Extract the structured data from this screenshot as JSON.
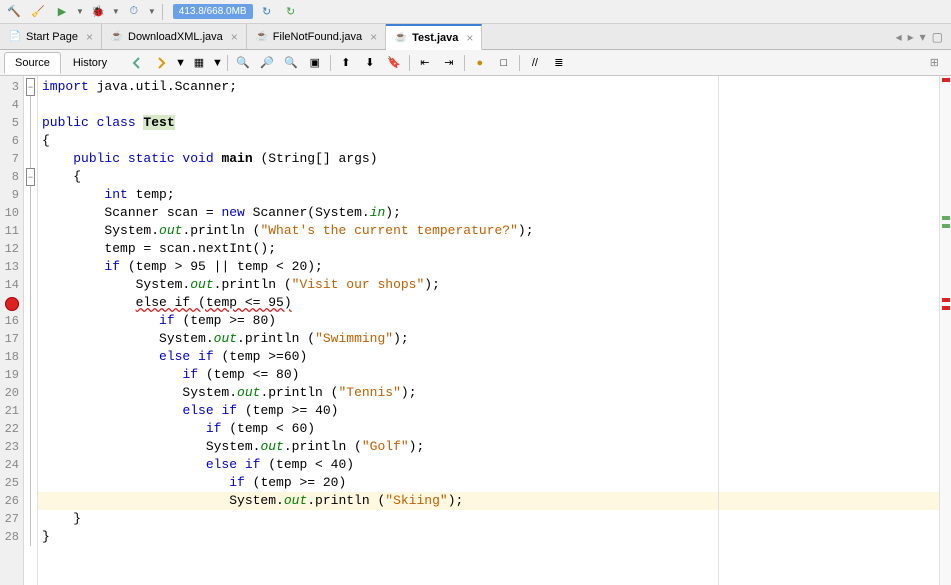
{
  "memory": "413.8/668.0MB",
  "tabs": [
    {
      "label": "Start Page",
      "icon": "page",
      "active": false
    },
    {
      "label": "DownloadXML.java",
      "icon": "java",
      "active": false
    },
    {
      "label": "FileNotFound.java",
      "icon": "java",
      "active": false
    },
    {
      "label": "Test.java",
      "icon": "java",
      "active": true
    }
  ],
  "views": {
    "source": "Source",
    "history": "History"
  },
  "gutter": [
    "3",
    "4",
    "5",
    "6",
    "7",
    "8",
    "9",
    "10",
    "11",
    "12",
    "13",
    "14",
    "",
    "16",
    "17",
    "18",
    "19",
    "20",
    "21",
    "22",
    "23",
    "24",
    "25",
    "26",
    "27",
    "28"
  ],
  "error_line_index": 12,
  "highlight_index": 23,
  "code": [
    [
      {
        "t": "import ",
        "c": "kw"
      },
      {
        "t": "java.util.Scanner;"
      }
    ],
    [
      {
        "t": ""
      }
    ],
    [
      {
        "t": "public class ",
        "c": "kw"
      },
      {
        "t": "Test",
        "c": "classname"
      }
    ],
    [
      {
        "t": "{"
      }
    ],
    [
      {
        "t": "    "
      },
      {
        "t": "public static void ",
        "c": "kw"
      },
      {
        "t": "main",
        "c": "method"
      },
      {
        "t": " (String[] args)"
      }
    ],
    [
      {
        "t": "    {"
      }
    ],
    [
      {
        "t": "        "
      },
      {
        "t": "int ",
        "c": "kw"
      },
      {
        "t": "temp;"
      }
    ],
    [
      {
        "t": "        Scanner scan = "
      },
      {
        "t": "new ",
        "c": "kw"
      },
      {
        "t": "Scanner(System."
      },
      {
        "t": "in",
        "c": "field"
      },
      {
        "t": ");"
      }
    ],
    [
      {
        "t": "        System."
      },
      {
        "t": "out",
        "c": "field"
      },
      {
        "t": ".println ("
      },
      {
        "t": "\"What's the current temperature?\"",
        "c": "str"
      },
      {
        "t": ");"
      }
    ],
    [
      {
        "t": "        temp = scan.nextInt();"
      }
    ],
    [
      {
        "t": "        "
      },
      {
        "t": "if ",
        "c": "kw"
      },
      {
        "t": "(temp > 95 || temp < 20);"
      }
    ],
    [
      {
        "t": "            System."
      },
      {
        "t": "out",
        "c": "field"
      },
      {
        "t": ".println ("
      },
      {
        "t": "\"Visit our shops\"",
        "c": "str"
      },
      {
        "t": ");"
      }
    ],
    [
      {
        "t": "            "
      },
      {
        "t": "else if (temp <= 95)",
        "c": "err-underline"
      }
    ],
    [
      {
        "t": "               "
      },
      {
        "t": "if ",
        "c": "kw"
      },
      {
        "t": "(temp >= 80)"
      }
    ],
    [
      {
        "t": "               System."
      },
      {
        "t": "out",
        "c": "field"
      },
      {
        "t": ".println ("
      },
      {
        "t": "\"Swimming\"",
        "c": "str"
      },
      {
        "t": ");"
      }
    ],
    [
      {
        "t": "               "
      },
      {
        "t": "else if ",
        "c": "kw"
      },
      {
        "t": "(temp >=60)"
      }
    ],
    [
      {
        "t": "                  "
      },
      {
        "t": "if ",
        "c": "kw"
      },
      {
        "t": "(temp <= 80)"
      }
    ],
    [
      {
        "t": "                  System."
      },
      {
        "t": "out",
        "c": "field"
      },
      {
        "t": ".println ("
      },
      {
        "t": "\"Tennis\"",
        "c": "str"
      },
      {
        "t": ");"
      }
    ],
    [
      {
        "t": "                  "
      },
      {
        "t": "else if ",
        "c": "kw"
      },
      {
        "t": "(temp >= 40)"
      }
    ],
    [
      {
        "t": "                     "
      },
      {
        "t": "if ",
        "c": "kw"
      },
      {
        "t": "(temp < 60)"
      }
    ],
    [
      {
        "t": "                     System."
      },
      {
        "t": "out",
        "c": "field"
      },
      {
        "t": ".println ("
      },
      {
        "t": "\"Golf\"",
        "c": "str"
      },
      {
        "t": ");"
      }
    ],
    [
      {
        "t": "                     "
      },
      {
        "t": "else if ",
        "c": "kw"
      },
      {
        "t": "(temp < 40)"
      }
    ],
    [
      {
        "t": "                        "
      },
      {
        "t": "if ",
        "c": "kw"
      },
      {
        "t": "(temp >= 20)"
      }
    ],
    [
      {
        "t": "                        System."
      },
      {
        "t": "out",
        "c": "field"
      },
      {
        "t": ".println ("
      },
      {
        "t": "\"Skiing\"",
        "c": "str"
      },
      {
        "t": ");"
      }
    ],
    [
      {
        "t": "    }"
      }
    ],
    [
      {
        "t": "}"
      }
    ]
  ]
}
